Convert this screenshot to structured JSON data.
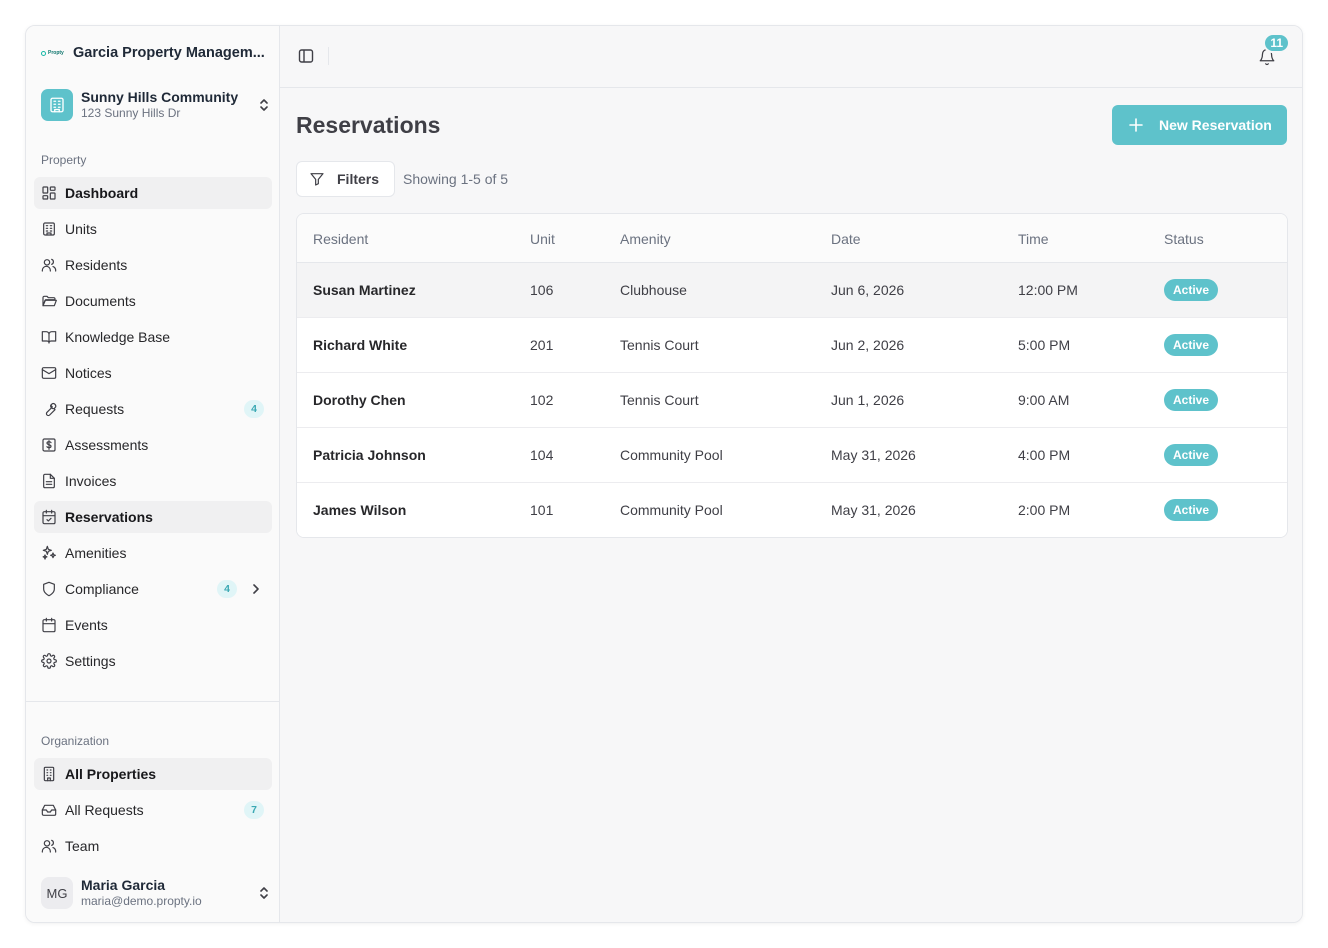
{
  "sidebar": {
    "logo_text": "Propty",
    "org_name": "Garcia Property Managem...",
    "community": {
      "name": "Sunny Hills Community",
      "address": "123 Sunny Hills Dr"
    },
    "property_section_label": "Property",
    "property_items": [
      {
        "label": "Dashboard",
        "icon": "dashboard-icon",
        "active": true
      },
      {
        "label": "Units",
        "icon": "building-icon"
      },
      {
        "label": "Residents",
        "icon": "users-icon"
      },
      {
        "label": "Documents",
        "icon": "folder-icon"
      },
      {
        "label": "Knowledge Base",
        "icon": "book-icon"
      },
      {
        "label": "Notices",
        "icon": "mail-icon"
      },
      {
        "label": "Requests",
        "icon": "wrench-icon",
        "badge": "4"
      },
      {
        "label": "Assessments",
        "icon": "dollar-icon"
      },
      {
        "label": "Invoices",
        "icon": "file-icon"
      },
      {
        "label": "Reservations",
        "icon": "calendar-check-icon",
        "active": true
      },
      {
        "label": "Amenities",
        "icon": "sparkles-icon"
      },
      {
        "label": "Compliance",
        "icon": "shield-icon",
        "badge": "4",
        "chevron": true
      },
      {
        "label": "Events",
        "icon": "calendar-icon"
      },
      {
        "label": "Settings",
        "icon": "gear-icon"
      }
    ],
    "org_section_label": "Organization",
    "org_items": [
      {
        "label": "All Properties",
        "icon": "building-office-icon",
        "active": true
      },
      {
        "label": "All Requests",
        "icon": "inbox-icon",
        "badge": "7"
      },
      {
        "label": "Team",
        "icon": "users-icon"
      }
    ],
    "user": {
      "initials": "MG",
      "name": "Maria Garcia",
      "email": "maria@demo.propty.io"
    }
  },
  "topbar": {
    "notification_count": "11"
  },
  "page": {
    "title": "Reservations",
    "new_button_label": "New Reservation",
    "filters_label": "Filters",
    "showing_text": "Showing 1-5 of 5"
  },
  "table": {
    "columns": [
      "Resident",
      "Unit",
      "Amenity",
      "Date",
      "Time",
      "Status"
    ],
    "rows": [
      {
        "resident": "Susan Martinez",
        "unit": "106",
        "amenity": "Clubhouse",
        "date": "Jun 6, 2026",
        "time": "12:00 PM",
        "status": "Active"
      },
      {
        "resident": "Richard White",
        "unit": "201",
        "amenity": "Tennis Court",
        "date": "Jun 2, 2026",
        "time": "5:00 PM",
        "status": "Active"
      },
      {
        "resident": "Dorothy Chen",
        "unit": "102",
        "amenity": "Tennis Court",
        "date": "Jun 1, 2026",
        "time": "9:00 AM",
        "status": "Active"
      },
      {
        "resident": "Patricia Johnson",
        "unit": "104",
        "amenity": "Community Pool",
        "date": "May 31, 2026",
        "time": "4:00 PM",
        "status": "Active"
      },
      {
        "resident": "James Wilson",
        "unit": "101",
        "amenity": "Community Pool",
        "date": "May 31, 2026",
        "time": "2:00 PM",
        "status": "Active"
      }
    ]
  },
  "colors": {
    "accent": "#5ec2cb",
    "badge_bg": "#e0f5f7",
    "badge_text": "#3aa8b3"
  }
}
